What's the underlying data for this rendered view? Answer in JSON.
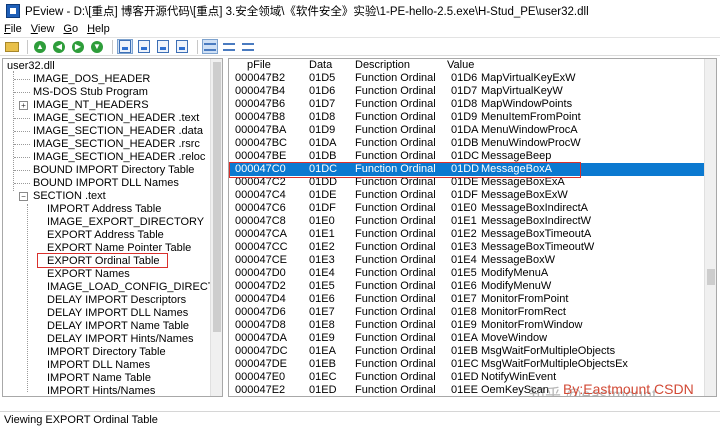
{
  "window": {
    "title": "PEview - D:\\[重点] 博客开源代码\\[重点] 3.安全领域\\《软件安全》实验\\1-PE-hello-2.5.exe\\H-Stud_PE\\user32.dll"
  },
  "menu": [
    {
      "underline": "F",
      "rest": "ile"
    },
    {
      "underline": "V",
      "rest": "iew"
    },
    {
      "underline": "G",
      "rest": "o"
    },
    {
      "underline": "H",
      "rest": "elp"
    }
  ],
  "tree": {
    "root": "user32.dll",
    "items": [
      {
        "label": "IMAGE_DOS_HEADER"
      },
      {
        "label": "MS-DOS Stub Program"
      },
      {
        "label": "IMAGE_NT_HEADERS"
      },
      {
        "label": "IMAGE_SECTION_HEADER .text"
      },
      {
        "label": "IMAGE_SECTION_HEADER .data"
      },
      {
        "label": "IMAGE_SECTION_HEADER .rsrc"
      },
      {
        "label": "IMAGE_SECTION_HEADER .reloc"
      },
      {
        "label": "BOUND IMPORT Directory Table"
      },
      {
        "label": "BOUND IMPORT DLL Names"
      },
      {
        "label": "SECTION .text"
      },
      {
        "label": "IMPORT Address Table"
      },
      {
        "label": "IMAGE_EXPORT_DIRECTORY"
      },
      {
        "label": "EXPORT Address Table"
      },
      {
        "label": "EXPORT Name Pointer Table"
      },
      {
        "label": "EXPORT Ordinal Table"
      },
      {
        "label": "EXPORT Names"
      },
      {
        "label": "IMAGE_LOAD_CONFIG_DIRECTORY"
      },
      {
        "label": "DELAY IMPORT Descriptors"
      },
      {
        "label": "DELAY IMPORT DLL Names"
      },
      {
        "label": "DELAY IMPORT Name Table"
      },
      {
        "label": "DELAY IMPORT Hints/Names"
      },
      {
        "label": "IMPORT Directory Table"
      },
      {
        "label": "IMPORT DLL Names"
      },
      {
        "label": "IMPORT Name Table"
      },
      {
        "label": "IMPORT Hints/Names"
      }
    ]
  },
  "table": {
    "columns": [
      "pFile",
      "Data",
      "Description",
      "Value"
    ],
    "rows": [
      [
        "000047B2",
        "01D5",
        "Function Ordinal",
        "01D6",
        "MapVirtualKeyExW"
      ],
      [
        "000047B4",
        "01D6",
        "Function Ordinal",
        "01D7",
        "MapVirtualKeyW"
      ],
      [
        "000047B6",
        "01D7",
        "Function Ordinal",
        "01D8",
        "MapWindowPoints"
      ],
      [
        "000047B8",
        "01D8",
        "Function Ordinal",
        "01D9",
        "MenuItemFromPoint"
      ],
      [
        "000047BA",
        "01D9",
        "Function Ordinal",
        "01DA",
        "MenuWindowProcA"
      ],
      [
        "000047BC",
        "01DA",
        "Function Ordinal",
        "01DB",
        "MenuWindowProcW"
      ],
      [
        "000047BE",
        "01DB",
        "Function Ordinal",
        "01DC",
        "MessageBeep"
      ],
      [
        "000047C0",
        "01DC",
        "Function Ordinal",
        "01DD",
        "MessageBoxA"
      ],
      [
        "000047C2",
        "01DD",
        "Function Ordinal",
        "01DE",
        "MessageBoxExA"
      ],
      [
        "000047C4",
        "01DE",
        "Function Ordinal",
        "01DF",
        "MessageBoxExW"
      ],
      [
        "000047C6",
        "01DF",
        "Function Ordinal",
        "01E0",
        "MessageBoxIndirectA"
      ],
      [
        "000047C8",
        "01E0",
        "Function Ordinal",
        "01E1",
        "MessageBoxIndirectW"
      ],
      [
        "000047CA",
        "01E1",
        "Function Ordinal",
        "01E2",
        "MessageBoxTimeoutA"
      ],
      [
        "000047CC",
        "01E2",
        "Function Ordinal",
        "01E3",
        "MessageBoxTimeoutW"
      ],
      [
        "000047CE",
        "01E3",
        "Function Ordinal",
        "01E4",
        "MessageBoxW"
      ],
      [
        "000047D0",
        "01E4",
        "Function Ordinal",
        "01E5",
        "ModifyMenuA"
      ],
      [
        "000047D2",
        "01E5",
        "Function Ordinal",
        "01E6",
        "ModifyMenuW"
      ],
      [
        "000047D4",
        "01E6",
        "Function Ordinal",
        "01E7",
        "MonitorFromPoint"
      ],
      [
        "000047D6",
        "01E7",
        "Function Ordinal",
        "01E8",
        "MonitorFromRect"
      ],
      [
        "000047D8",
        "01E8",
        "Function Ordinal",
        "01E9",
        "MonitorFromWindow"
      ],
      [
        "000047DA",
        "01E9",
        "Function Ordinal",
        "01EA",
        "MoveWindow"
      ],
      [
        "000047DC",
        "01EA",
        "Function Ordinal",
        "01EB",
        "MsgWaitForMultipleObjects"
      ],
      [
        "000047DE",
        "01EB",
        "Function Ordinal",
        "01EC",
        "MsgWaitForMultipleObjectsEx"
      ],
      [
        "000047E0",
        "01EC",
        "Function Ordinal",
        "01ED",
        "NotifyWinEvent"
      ],
      [
        "000047E2",
        "01ED",
        "Function Ordinal",
        "01EE",
        "OemKeyScan"
      ]
    ]
  },
  "watermark": {
    "zhihu": "知乎 @eastmount",
    "csdn": "By:Eastmount CSDN"
  },
  "status": {
    "text": "Viewing EXPORT Ordinal Table"
  },
  "colors": {
    "selection": "#0b79d0",
    "highlight_box": "#d9302c"
  }
}
